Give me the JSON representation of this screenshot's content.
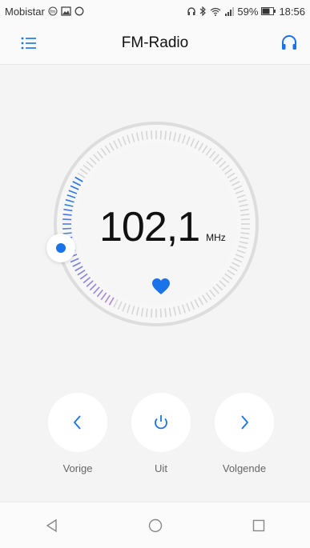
{
  "status": {
    "carrier": "Mobistar",
    "battery": "59%",
    "time": "18:56"
  },
  "appbar": {
    "title": "FM-Radio"
  },
  "tuner": {
    "frequency": "102,1",
    "unit": "MHz"
  },
  "controls": {
    "prev_label": "Vorige",
    "power_label": "Uit",
    "next_label": "Volgende"
  },
  "colors": {
    "accent": "#1a73e8",
    "gradient_end": "#b18bdc"
  }
}
